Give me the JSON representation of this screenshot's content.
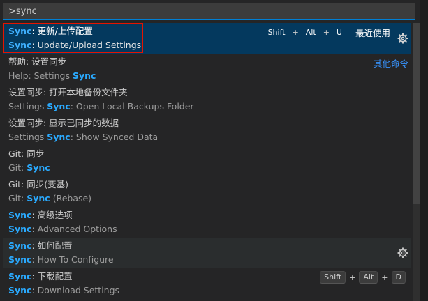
{
  "search": {
    "value": ">sync",
    "placeholder": ""
  },
  "labels": {
    "recently_used": "最近使用",
    "other_commands": "其他命令"
  },
  "colors": {
    "selected_bg": "#04395e",
    "highlight": "#2aaaff",
    "focus_border": "#007fd4",
    "annotation_box": "#e51400"
  },
  "items": [
    {
      "line1": {
        "hl": "Sync",
        "rest": ": 更新/上传配置"
      },
      "line2": {
        "pre": "",
        "hl": "Sync",
        "post": ": Update/Upload Settings"
      },
      "keys": [
        "Shift",
        "Alt",
        "U"
      ]
    },
    {
      "line1": {
        "hl": "",
        "rest": "帮助: 设置同步"
      },
      "line2": {
        "pre": "Help: Settings ",
        "hl": "Sync",
        "post": ""
      }
    },
    {
      "line1": {
        "hl": "",
        "rest": "设置同步: 打开本地备份文件夹"
      },
      "line2": {
        "pre": "Settings ",
        "hl": "Sync",
        "post": ": Open Local Backups Folder"
      }
    },
    {
      "line1": {
        "hl": "",
        "rest": "设置同步: 显示已同步的数据"
      },
      "line2": {
        "pre": "Settings ",
        "hl": "Sync",
        "post": ": Show Synced Data"
      }
    },
    {
      "line1": {
        "hl": "",
        "rest": "Git: 同步"
      },
      "line2": {
        "pre": "Git: ",
        "hl": "Sync",
        "post": ""
      }
    },
    {
      "line1": {
        "hl": "",
        "rest": "Git: 同步(变基)"
      },
      "line2": {
        "pre": "Git: ",
        "hl": "Sync",
        "post": " (Rebase)"
      }
    },
    {
      "line1": {
        "hl": "Sync",
        "rest": ": 高级选项"
      },
      "line2": {
        "pre": "",
        "hl": "Sync",
        "post": ": Advanced Options"
      }
    },
    {
      "line1": {
        "hl": "Sync",
        "rest": ": 如何配置"
      },
      "line2": {
        "pre": "",
        "hl": "Sync",
        "post": ": How To Configure"
      }
    },
    {
      "line1": {
        "hl": "Sync",
        "rest": ": 下载配置"
      },
      "line2": {
        "pre": "",
        "hl": "Sync",
        "post": ": Download Settings"
      },
      "keys": [
        "Shift",
        "Alt",
        "D"
      ]
    }
  ]
}
